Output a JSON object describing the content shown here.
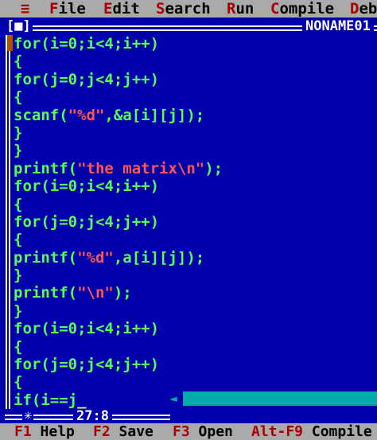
{
  "menu": {
    "system_glyph": "≡",
    "items": [
      {
        "hot": "F",
        "rest": "ile"
      },
      {
        "hot": "E",
        "rest": "dit"
      },
      {
        "hot": "S",
        "rest": "earch"
      },
      {
        "hot": "R",
        "rest": "un"
      },
      {
        "hot": "C",
        "rest": "ompile"
      },
      {
        "hot": "D",
        "rest": "ebu"
      }
    ]
  },
  "window": {
    "close_box": "[■]",
    "filename": "NONAME01"
  },
  "code_lines": [
    [
      {
        "t": "for(i=0;i<4;i++)",
        "c": "k"
      }
    ],
    [
      {
        "t": "{",
        "c": "k"
      }
    ],
    [
      {
        "t": "for(j=0;j<4;j++)",
        "c": "k"
      }
    ],
    [
      {
        "t": "{",
        "c": "k"
      }
    ],
    [
      {
        "t": "scanf(",
        "c": "k"
      },
      {
        "t": "\"%d\"",
        "c": "s"
      },
      {
        "t": ",&a[i][j]);",
        "c": "k"
      }
    ],
    [
      {
        "t": "}",
        "c": "k"
      }
    ],
    [
      {
        "t": "}",
        "c": "k"
      }
    ],
    [
      {
        "t": "printf(",
        "c": "k"
      },
      {
        "t": "\"the matrix\\n\"",
        "c": "s"
      },
      {
        "t": ");",
        "c": "k"
      }
    ],
    [
      {
        "t": "for(i=0;i<4;i++)",
        "c": "k"
      }
    ],
    [
      {
        "t": "{",
        "c": "k"
      }
    ],
    [
      {
        "t": "for(j=0;j<4;j++)",
        "c": "k"
      }
    ],
    [
      {
        "t": "{",
        "c": "k"
      }
    ],
    [
      {
        "t": "printf(",
        "c": "k"
      },
      {
        "t": "\"%d\"",
        "c": "s"
      },
      {
        "t": ",a[i][j]);",
        "c": "k"
      }
    ],
    [
      {
        "t": "}",
        "c": "k"
      }
    ],
    [
      {
        "t": "printf(",
        "c": "k"
      },
      {
        "t": "\"\\n\"",
        "c": "s"
      },
      {
        "t": ");",
        "c": "k"
      }
    ],
    [
      {
        "t": "}",
        "c": "k"
      }
    ],
    [
      {
        "t": "for(i=0;i<4;i++)",
        "c": "k"
      }
    ],
    [
      {
        "t": "{",
        "c": "k"
      }
    ],
    [
      {
        "t": "for(j=0;j<4;j++)",
        "c": "k"
      }
    ],
    [
      {
        "t": "{",
        "c": "k"
      }
    ],
    [
      {
        "t": "if(i==j",
        "c": "p"
      },
      {
        "t": "_",
        "c": "cursor"
      }
    ]
  ],
  "status": {
    "star": "✳",
    "position": "27:8"
  },
  "fnkeys": [
    {
      "key": "F1",
      "label": "Help"
    },
    {
      "key": "F2",
      "label": "Save"
    },
    {
      "key": "F3",
      "label": "Open"
    },
    {
      "key": "Alt-F9",
      "label": "Compile"
    }
  ],
  "colors": {
    "editor_bg": "#0000aa",
    "menu_bg": "#aaaaaa",
    "hotkey": "#a80000",
    "code_text": "#55ff55",
    "string_text": "#ff5555",
    "scrollbar": "#00aaaa"
  }
}
